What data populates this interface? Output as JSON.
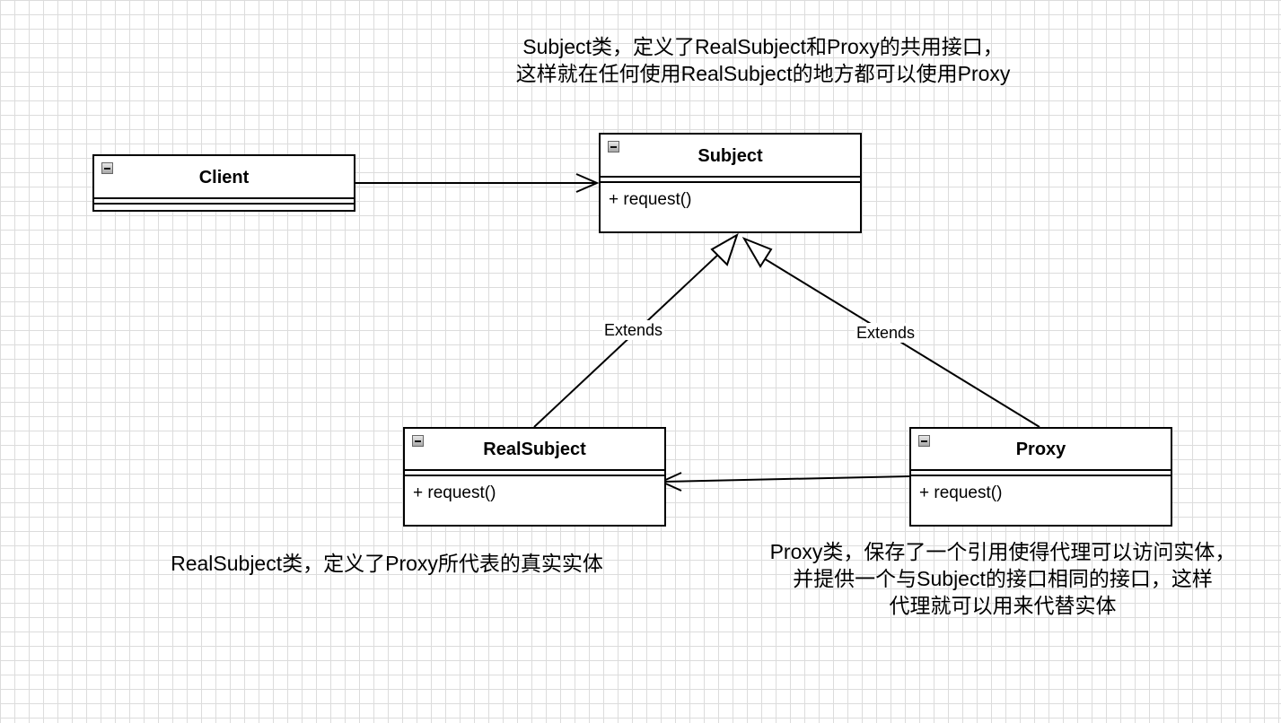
{
  "notes": {
    "subject": [
      "Subject类，定义了RealSubject和Proxy的共用接口，",
      "这样就在任何使用RealSubject的地方都可以使用Proxy"
    ],
    "real_subject": "RealSubject类，定义了Proxy所代表的真实实体",
    "proxy": [
      "Proxy类，保存了一个引用使得代理可以访问实体，",
      "并提供一个与Subject的接口相同的接口，这样",
      "代理就可以用来代替实体"
    ]
  },
  "classes": {
    "client": {
      "name": "Client"
    },
    "subject": {
      "name": "Subject",
      "method": "+ request()"
    },
    "real_subject": {
      "name": "RealSubject",
      "method": "+ request()"
    },
    "proxy": {
      "name": "Proxy",
      "method": "+ request()"
    }
  },
  "edges": {
    "real_subject_extends": "Extends",
    "proxy_extends": "Extends"
  }
}
